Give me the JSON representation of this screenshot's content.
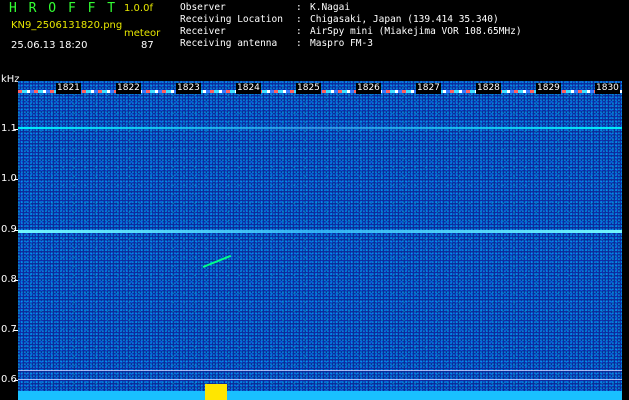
{
  "header": {
    "app_title": "H R O F F T",
    "zoom": "1.0.0f",
    "filename": "KN9_2506131820.png",
    "unit_label": "meteor",
    "timestamp": "25.06.13 18:20",
    "count": "87"
  },
  "metadata": [
    {
      "key": "Observer",
      "sep": ":",
      "value": "K.Nagai"
    },
    {
      "key": "Receiving Location",
      "sep": ":",
      "value": "Chigasaki, Japan (139.414 35.340)"
    },
    {
      "key": "Receiver",
      "sep": ":",
      "value": "AirSpy mini (Miakejima VOR 108.65MHz)"
    },
    {
      "key": "Receiving antenna",
      "sep": ":",
      "value": "Maspro FM-3"
    }
  ],
  "y_axis": {
    "unit": "kHz",
    "ticks": [
      "1.1",
      "1.0",
      "0.9",
      "0.8",
      "0.7",
      "0.6"
    ]
  },
  "minute_marks": [
    "1821",
    "1822",
    "1823",
    "1824",
    "1825",
    "1826",
    "1827",
    "1828",
    "1829",
    "1830"
  ],
  "colors": {
    "background": "#0c2a9a",
    "title": "#33ff33",
    "accent": "#e6e600",
    "baseline_bar": "#19c0ff",
    "burst": "#ffe600"
  }
}
